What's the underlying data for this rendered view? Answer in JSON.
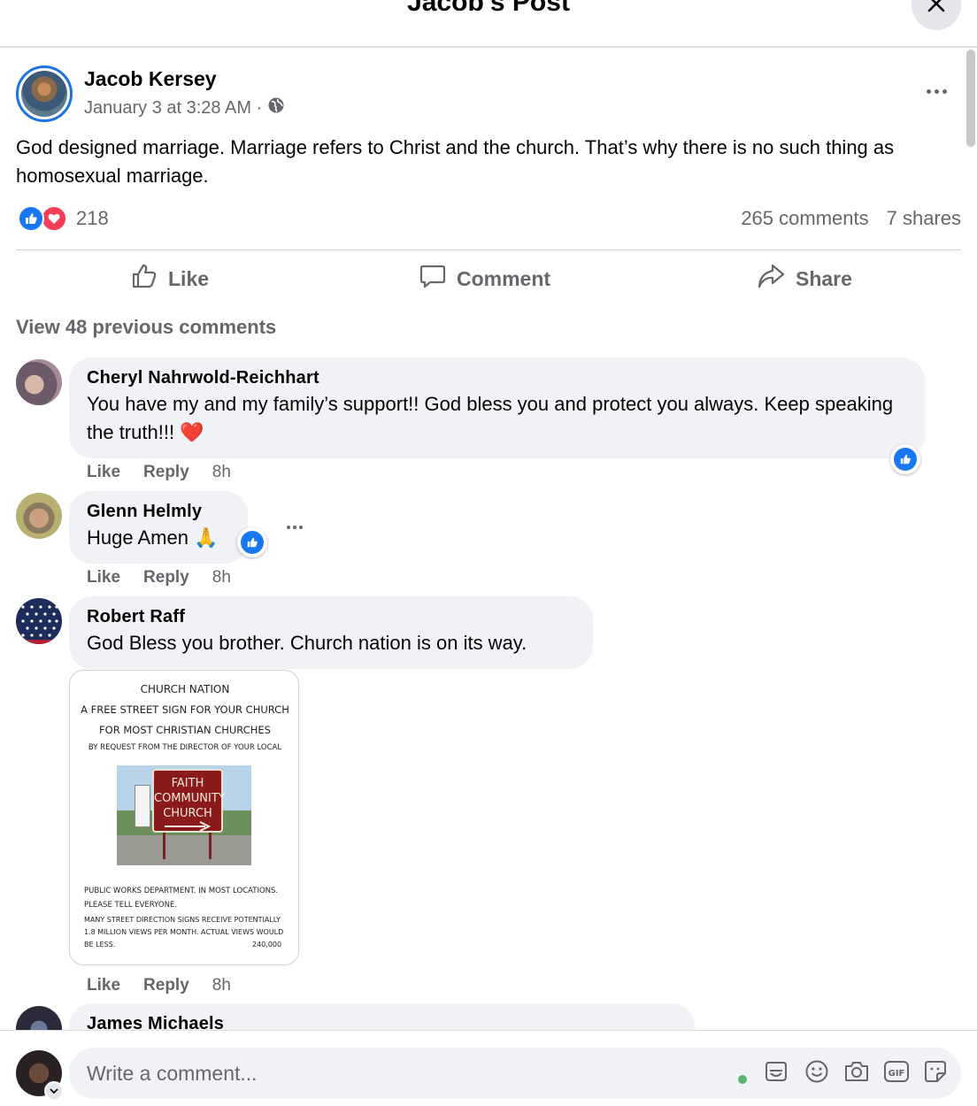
{
  "header": {
    "title": "Jacob's Post"
  },
  "post": {
    "author": "Jacob Kersey",
    "date": "January 3 at 3:28 AM ·",
    "text": "God designed marriage. Marriage refers to Christ and the church. That’s why there is no such thing as homosexual marriage.",
    "reaction_count": "218",
    "comments_count": "265 comments",
    "shares_count": "7 shares"
  },
  "actions": {
    "like": "Like",
    "comment": "Comment",
    "share": "Share"
  },
  "view_previous": "View 48 previous comments",
  "comments": [
    {
      "name": "Cheryl Nahrwold-Reichhart",
      "text": "You have my and my family’s support!! God bless you and protect you always. Keep speaking the truth!!! ❤️",
      "like": "Like",
      "reply": "Reply",
      "time": "8h"
    },
    {
      "name": "Glenn Helmly",
      "text": "Huge Amen 🙏",
      "like": "Like",
      "reply": "Reply",
      "time": "8h"
    },
    {
      "name": "Robert Raff",
      "text": "God Bless you brother. Church nation is on its way.",
      "like": "Like",
      "reply": "Reply",
      "time": "8h"
    },
    {
      "name": "James Michaels"
    }
  ],
  "attachment": {
    "line1": "CHURCH NATION",
    "line2": "A FREE STREET SIGN FOR YOUR CHURCH",
    "line3": "FOR MOST CHRISTIAN CHURCHES",
    "line4": "BY REQUEST FROM THE DIRECTOR OF YOUR LOCAL",
    "sign_line1": "FAITH",
    "sign_line2": "COMMUNITY",
    "sign_line3": "CHURCH",
    "foot1": "PUBLIC WORKS DEPARTMENT.  IN MOST LOCATIONS.",
    "foot2": "PLEASE TELL EVERYONE.",
    "foot3": "MANY STREET DIRECTION SIGNS RECEIVE POTENTIALLY",
    "foot4": "1.8 MILLION VIEWS PER MONTH. ACTUAL VIEWS WOULD",
    "foot5": "BE LESS.",
    "foot6": "240,000"
  },
  "composer": {
    "placeholder": "Write a comment..."
  },
  "icons": {
    "close": "close-icon",
    "more": "more-icon",
    "globe": "globe-icon",
    "like": "thumbs-up-icon",
    "love": "heart-icon",
    "comment": "comment-icon",
    "share": "share-icon",
    "avatar_sticker": "avatar-sticker-icon",
    "emoji": "emoji-icon",
    "camera": "camera-icon",
    "gif": "gif-icon",
    "sticker": "sticker-icon"
  },
  "colors": {
    "accent": "#1877f2",
    "love": "#f33e58",
    "secondary_text": "#65676b",
    "bubble": "#f0f2f5"
  }
}
